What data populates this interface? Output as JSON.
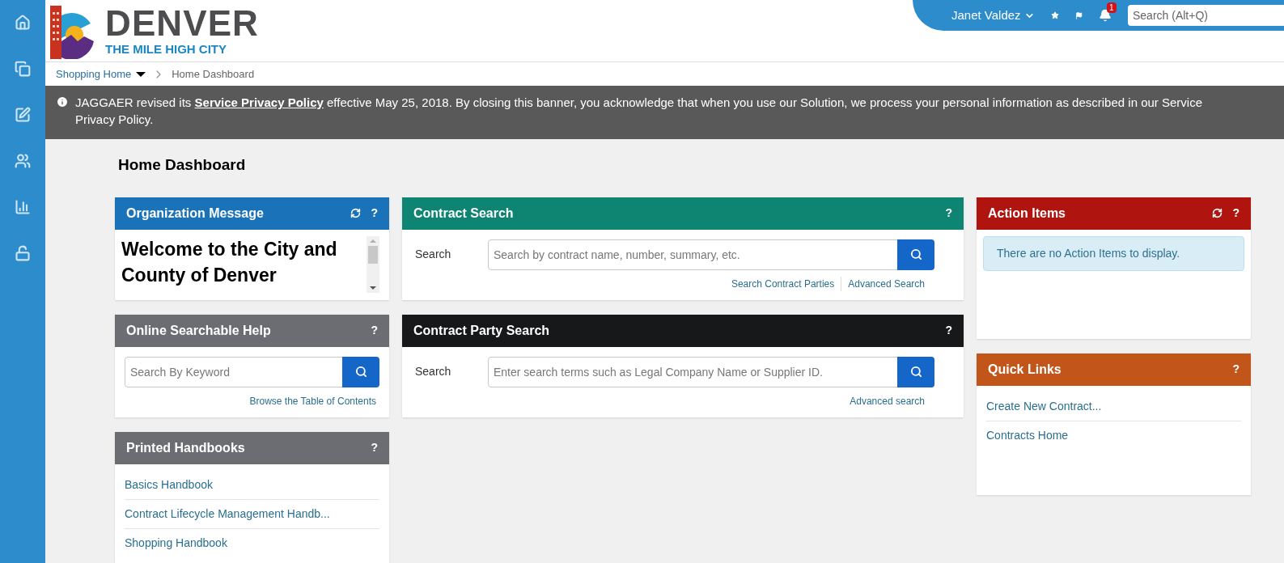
{
  "header": {
    "logo_title": "DENVER",
    "logo_tagline": "THE MILE HIGH CITY",
    "user": "Janet Valdez",
    "notification_count": "1",
    "search": {
      "placeholder": "Search (Alt+Q)"
    }
  },
  "breadcrumb": [
    {
      "label": "Shopping Home",
      "kind": "menu"
    },
    {
      "label": "Home Dashboard",
      "kind": "current"
    }
  ],
  "banner": {
    "before": "JAGGAER revised its",
    "link": "Service Privacy Policy",
    "after": "effective May 25, 2018. By closing this banner, you acknowledge that when you use our Solution, we process your personal information as described in our Service Privacy Policy."
  },
  "page_title": "Home Dashboard",
  "columns": [
    [
      {
        "kind": "message",
        "title": "Organization Message",
        "color": "#1a73b8",
        "refresh": true,
        "help": "?",
        "message": "Welcome to the City and County of Denver"
      },
      {
        "kind": "help_search",
        "title": "Online Searchable Help",
        "color": "#6b6d72",
        "refresh": false,
        "help": "?",
        "placeholder": "Search By Keyword",
        "links": [
          "Browse the Table of Contents"
        ]
      },
      {
        "kind": "links",
        "title": "Printed Handbooks",
        "color": "#6b6d72",
        "refresh": false,
        "help": "?",
        "links": [
          "Basics Handbook",
          "Contract Lifecycle Management Handb...",
          "Shopping Handbook"
        ]
      }
    ],
    [
      {
        "kind": "search",
        "title": "Contract Search",
        "color": "#0e8472",
        "refresh": false,
        "help": "?",
        "label": "Search",
        "placeholder": "Search by contract name, number, summary, etc.",
        "links": [
          "Search Contract Parties",
          "Advanced Search"
        ]
      },
      {
        "kind": "search",
        "title": "Contract Party Search",
        "color": "#17181a",
        "refresh": false,
        "help": "?",
        "label": "Search",
        "placeholder": "Enter search terms such as Legal Company Name or Supplier ID.",
        "links": [
          "Advanced search"
        ]
      }
    ],
    [
      {
        "kind": "notice",
        "title": "Action Items",
        "color": "#b0140f",
        "refresh": true,
        "help": "?",
        "notice": "There are no Action Items to display."
      },
      {
        "kind": "links",
        "title": "Quick Links",
        "color": "#c2561a",
        "refresh": false,
        "help": "?",
        "links": [
          "Create New Contract...",
          "Contracts Home"
        ]
      }
    ]
  ]
}
